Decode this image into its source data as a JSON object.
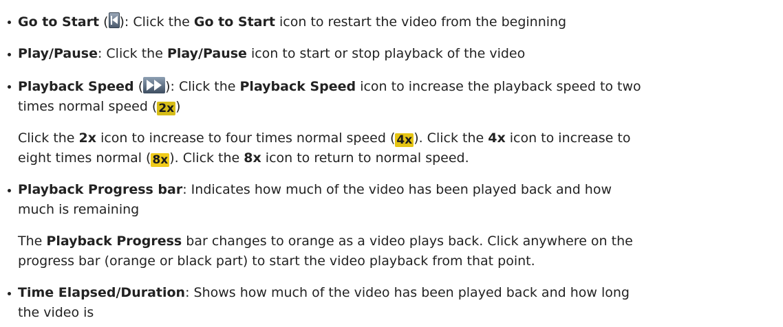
{
  "items": [
    {
      "term": "Go to Start",
      "pre_icon": " (",
      "post_icon": "): Click the ",
      "term_repeat": "Go to Start",
      "rest": " icon to restart the video from the beginning",
      "icon": "go-to-start-icon"
    },
    {
      "term": "Play/Pause",
      "mid": ": Click the ",
      "term_repeat": "Play/Pause",
      "rest": " icon to start or stop playback of the video"
    },
    {
      "term": "Playback Speed",
      "pre_icon": " (",
      "post_icon": "): Click the ",
      "term_repeat": "Playback Speed",
      "rest": " icon to increase the playback speed to two",
      "line2_pre": "times normal speed (",
      "badge": "2x",
      "line2_post": ")",
      "icon": "fast-forward-icon",
      "sub": {
        "s1": "Click the ",
        "b1": "2x",
        "s2": " icon to increase to four times normal speed (",
        "badge1": "4x",
        "s3": "). Click the ",
        "b2": "4x",
        "s4": " icon to increase to",
        "s5": "eight times normal (",
        "badge2": "8x",
        "s6": "). Click the ",
        "b3": "8x",
        "s7": " icon to return to normal speed."
      }
    },
    {
      "term": "Playback Progress bar",
      "rest": ": Indicates how much of the video has been played back and how",
      "line2": "much is remaining",
      "sub": {
        "s1": "The ",
        "b1": "Playback Progress",
        "s2": " bar changes to orange as a video plays back. Click anywhere on the",
        "s3": "progress bar (orange or black part) to start the video playback from that point."
      }
    },
    {
      "term": "Time Elapsed/Duration",
      "rest": ": Shows how much of the video has been played back and how long",
      "line2": "the video is"
    }
  ],
  "colors": {
    "text": "#222222",
    "badge_yellow": "#e5c413"
  }
}
